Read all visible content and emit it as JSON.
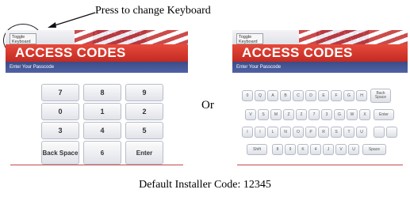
{
  "callout": {
    "text": "Press to change Keyboard"
  },
  "screen": {
    "toggle_label": "Toggle Keyboard",
    "title": "ACCESS CODES",
    "subtitle": "Enter Your Passcode"
  },
  "numeric_keys": [
    "7",
    "8",
    "9",
    "0",
    "1",
    "2",
    "3",
    "4",
    "5",
    "Back Space",
    "6",
    "Enter"
  ],
  "separator": "Or",
  "alpha_rows": [
    [
      "0",
      "Q",
      "A",
      "B",
      "C",
      "D",
      "E",
      "F",
      "G",
      "H"
    ],
    [
      "V",
      "S",
      "M",
      "Z",
      "2",
      "7",
      "3",
      "G",
      "W",
      "X"
    ],
    [
      "I",
      "I",
      "L",
      "N",
      "O",
      "P",
      "R",
      "S",
      "T",
      "U"
    ],
    [
      "Shift",
      "8",
      "9",
      "K",
      "4",
      "J",
      "V",
      "U"
    ]
  ],
  "alpha_special": {
    "back": "Back Space",
    "enter": "Enter",
    "space": "Space"
  },
  "footer": "Default Installer Code: 12345",
  "colors": {
    "title_red": "#d93a2e",
    "sub_blue": "#41508c",
    "flag_blue": "#27307a"
  }
}
